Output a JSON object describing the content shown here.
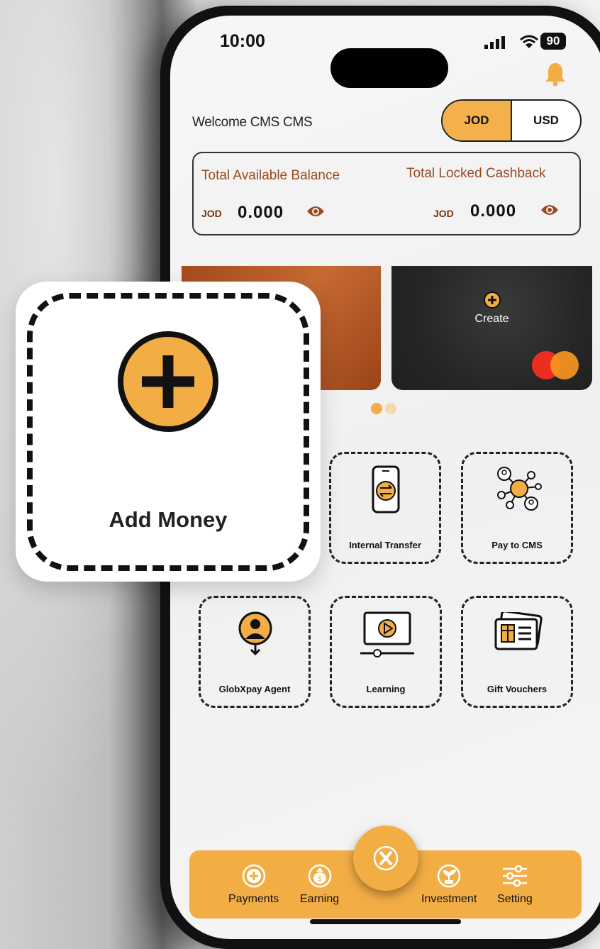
{
  "status_bar": {
    "time": "10:00",
    "battery": "90"
  },
  "header": {
    "welcome": "Welcome CMS CMS",
    "currency_options": [
      "JOD",
      "USD"
    ],
    "selected_currency": "JOD"
  },
  "balance": {
    "available_label": "Total Available Balance",
    "available_currency": "JOD",
    "available_value": "0.000",
    "locked_label": "Total Locked Cashback",
    "locked_currency": "JOD",
    "locked_value": "0.000"
  },
  "cards": {
    "create_label": "Create",
    "page_indicator": {
      "count": 2,
      "active": 0
    }
  },
  "services": [
    {
      "label": "Add Money",
      "icon": "plus-circle-icon"
    },
    {
      "label": "Internal Transfer",
      "icon": "phone-transfer-icon"
    },
    {
      "label": "Pay to CMS",
      "icon": "network-icon"
    },
    {
      "label": "GlobXpay Agent",
      "icon": "agent-pin-icon"
    },
    {
      "label": "Learning",
      "icon": "video-play-icon"
    },
    {
      "label": "Gift Vouchers",
      "icon": "gift-card-icon"
    }
  ],
  "nav": {
    "items": [
      {
        "label": "Payments",
        "icon": "plus-circle-icon"
      },
      {
        "label": "Earning",
        "icon": "money-bag-icon"
      },
      {
        "label": "Investment",
        "icon": "plant-icon"
      },
      {
        "label": "Setting",
        "icon": "sliders-icon"
      }
    ],
    "center_icon": "app-logo-icon"
  },
  "colors": {
    "accent": "#f2ad45",
    "dark": "#111111",
    "brown": "#9b4a1f"
  }
}
